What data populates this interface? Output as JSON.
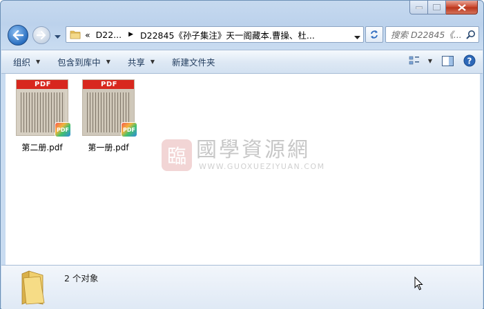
{
  "window": {
    "caption_buttons": [
      "minimize",
      "maximize",
      "close"
    ]
  },
  "nav": {
    "breadcrumb": {
      "prefix": "«",
      "parent": "D22...",
      "current": "D22845《孙子集注》天一阁藏本.曹操、杜..."
    },
    "search": {
      "placeholder": "搜索 D22845《..."
    }
  },
  "toolbar": {
    "organize": "组织",
    "include_in_library": "包含到库中",
    "share": "共享",
    "new_folder": "新建文件夹"
  },
  "files": [
    {
      "name": "第二册.pdf",
      "thumb_label": "PDF",
      "badge": "PDF"
    },
    {
      "name": "第一册.pdf",
      "thumb_label": "PDF",
      "badge": "PDF"
    }
  ],
  "watermark": {
    "seal_char": "臨",
    "title": "國學資源網",
    "url": "WWW.GUOXUEZIYUAN.COM"
  },
  "status": {
    "count": "2 个对象"
  },
  "colors": {
    "accent": "#1e395b",
    "pdf_red": "#d8271e",
    "frame": "#c6d9ef"
  }
}
